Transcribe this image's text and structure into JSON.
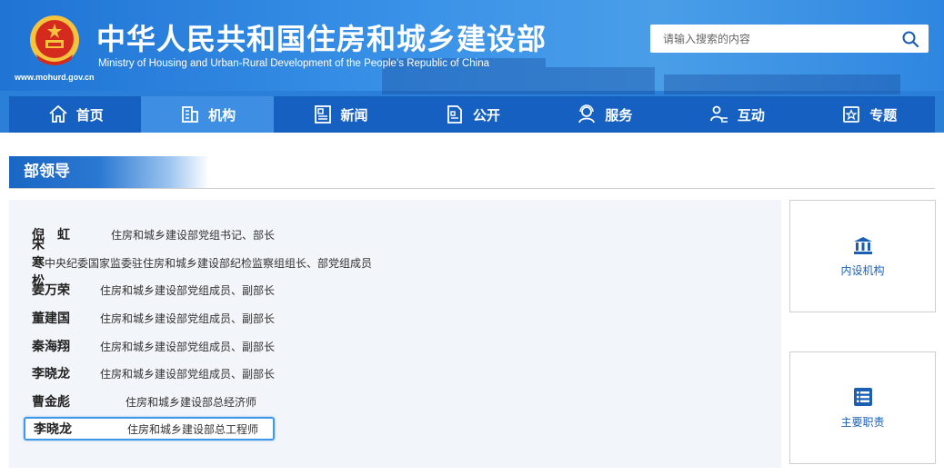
{
  "header": {
    "title_cn": "中华人民共和国住房和城乡建设部",
    "title_en": "Ministry of Housing and Urban-Rural Development of the People’s Republic of China",
    "site_url": "www.mohurd.gov.cn",
    "search_placeholder": "请输入搜索的内容"
  },
  "nav": {
    "items": [
      {
        "label": "首页",
        "icon": "home-icon",
        "active": false
      },
      {
        "label": "机构",
        "icon": "building-icon",
        "active": true
      },
      {
        "label": "新闻",
        "icon": "news-icon",
        "active": false
      },
      {
        "label": "公开",
        "icon": "document-icon",
        "active": false
      },
      {
        "label": "服务",
        "icon": "service-icon",
        "active": false
      },
      {
        "label": "互动",
        "icon": "interact-icon",
        "active": false
      },
      {
        "label": "专题",
        "icon": "topic-icon",
        "active": false
      }
    ]
  },
  "section": {
    "title": "部领导"
  },
  "leaders": [
    {
      "name": "倪　虹",
      "title": "住房和城乡建设部党组书记、部长"
    },
    {
      "name": "宋寒松",
      "title": "中央纪委国家监委驻住房和城乡建设部纪检监察组组长、部党组成员"
    },
    {
      "name": "姜万荣",
      "title": "住房和城乡建设部党组成员、副部长"
    },
    {
      "name": "董建国",
      "title": "住房和城乡建设部党组成员、副部长"
    },
    {
      "name": "秦海翔",
      "title": "住房和城乡建设部党组成员、副部长"
    },
    {
      "name": "李晓龙",
      "title": "住房和城乡建设部党组成员、副部长"
    },
    {
      "name": "曹金彪",
      "title": "住房和城乡建设部总经济师"
    },
    {
      "name": "李晓龙",
      "title": "住房和城乡建设部总工程师",
      "focused": true
    }
  ],
  "side": {
    "institutions": {
      "label": "内设机构",
      "icon": "institution-icon"
    },
    "duties": {
      "label": "主要职责",
      "icon": "list-icon"
    }
  },
  "colors": {
    "nav_bg": "#1560c1",
    "nav_active": "#3e8fe3",
    "link_blue": "#1a5fb4",
    "panel_bg": "#f2f5f9",
    "focus_border": "#3f97ea"
  }
}
